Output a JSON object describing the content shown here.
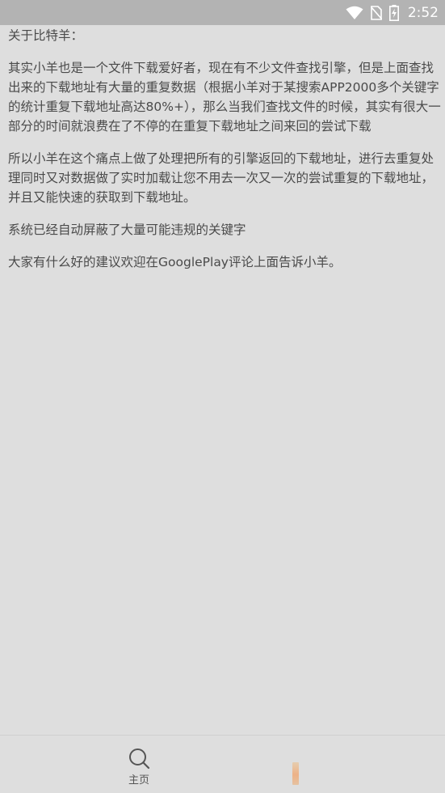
{
  "status_bar": {
    "time": "2:52",
    "icons": [
      "wifi-icon",
      "no-sim-icon",
      "battery-charging-icon"
    ]
  },
  "about": {
    "heading": "关于比特羊：",
    "paragraphs": [
      "其实小羊也是一个文件下载爱好者，现在有不少文件查找引擎，但是上面查找出来的下载地址有大量的重复数据（根据小羊对于某搜索APP2000多个关键字的统计重复下载地址高达80%+），那么当我们查找文件的时候，其实有很大一部分的时间就浪费在了不停的在重复下载地址之间来回的尝试下载",
      "所以小羊在这个痛点上做了处理把所有的引擎返回的下载地址，进行去重复处理同时又对数据做了实时加载让您不用去一次又一次的尝试重复的下载地址，并且又能快速的获取到下载地址。",
      "系统已经自动屏蔽了大量可能违规的关键字",
      "大家有什么好的建议欢迎在GooglePlay评论上面告诉小羊。"
    ]
  },
  "bottom_nav": {
    "home_label": "主页",
    "home_icon": "search-icon"
  }
}
